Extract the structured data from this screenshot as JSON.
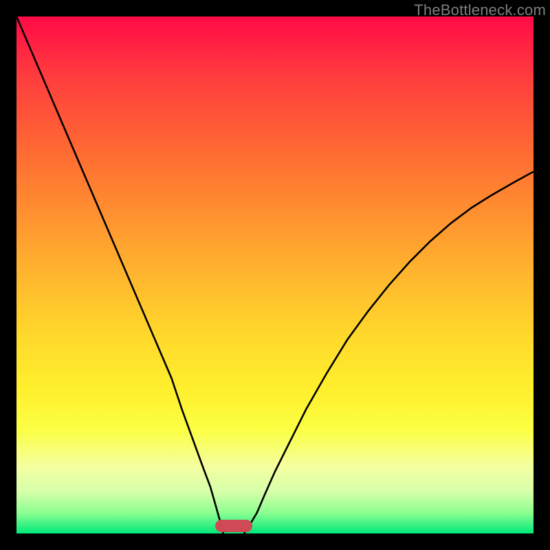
{
  "watermark": "TheBottleneck.com",
  "chart_data": {
    "type": "line",
    "title": "",
    "xlabel": "",
    "ylabel": "",
    "xlim": [
      0,
      100
    ],
    "ylim": [
      0,
      100
    ],
    "series": [
      {
        "name": "left-curve",
        "x": [
          0,
          3,
          6,
          9,
          12,
          15,
          18,
          21,
          24,
          27,
          30,
          32,
          34,
          36,
          37.5,
          38.5,
          39.2,
          39.7,
          40
        ],
        "y": [
          100,
          93,
          86,
          79,
          72,
          65,
          58,
          51,
          44,
          37,
          30,
          24,
          18.5,
          13,
          9,
          5.5,
          3,
          1.3,
          0
        ]
      },
      {
        "name": "right-curve",
        "x": [
          44,
          45,
          46.5,
          48,
          50,
          53,
          56,
          60,
          64,
          68,
          72,
          76,
          80,
          84,
          88,
          92,
          96,
          100
        ],
        "y": [
          0,
          1.5,
          4,
          7.5,
          12,
          18,
          24,
          31,
          37.5,
          43,
          48,
          52.5,
          56.5,
          60,
          63,
          65.5,
          67.8,
          70
        ]
      }
    ],
    "marker": {
      "x": 42,
      "y": 1.5
    },
    "background_gradient": {
      "top": "#ff0a46",
      "bottom": "#00e87a"
    }
  }
}
